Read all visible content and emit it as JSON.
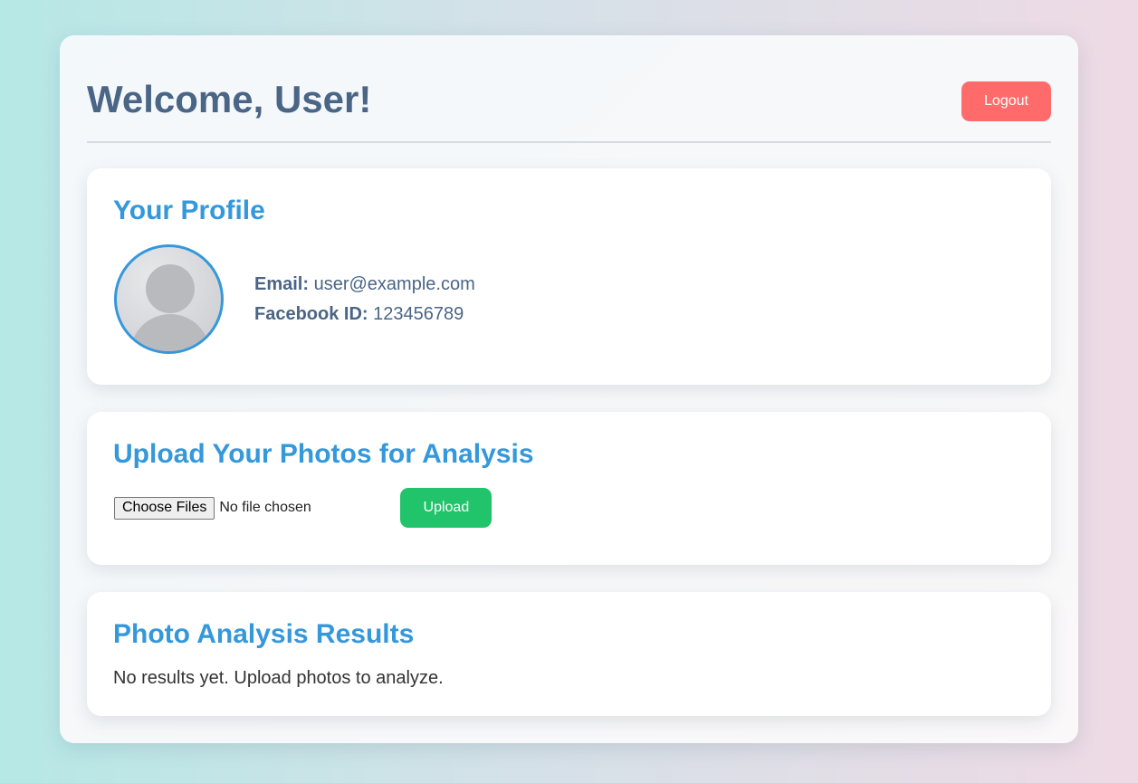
{
  "header": {
    "title": "Welcome, User!",
    "logout_label": "Logout"
  },
  "profile": {
    "heading": "Your Profile",
    "email_label": "Email:",
    "email_value": "user@example.com",
    "facebook_label": "Facebook ID:",
    "facebook_value": "123456789",
    "avatar_icon": "user-silhouette-icon"
  },
  "upload": {
    "heading": "Upload Your Photos for Analysis",
    "choose_files_label": "Choose Files",
    "file_status": "No file chosen",
    "upload_label": "Upload"
  },
  "results": {
    "heading": "Photo Analysis Results",
    "message": "No results yet. Upload photos to analyze."
  },
  "colors": {
    "heading_accent": "#3498db",
    "title_text": "#4a6585",
    "logout_button": "#ff6b6b",
    "upload_button": "#21c36b"
  }
}
